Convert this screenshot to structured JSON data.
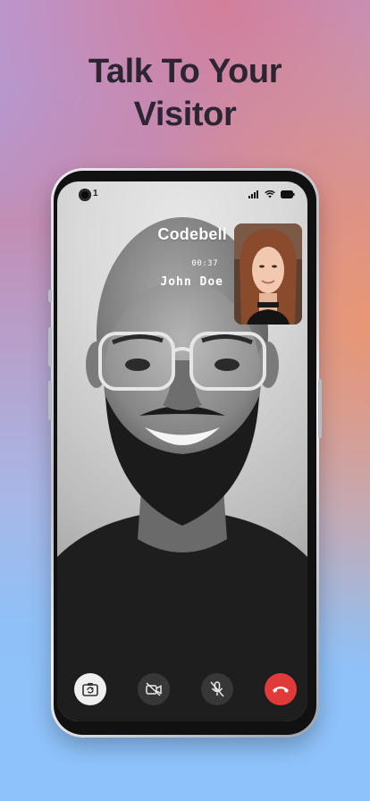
{
  "headline": {
    "line1": "Talk To Your",
    "line2": "Visitor"
  },
  "status_bar": {
    "indicator": "1",
    "icons": [
      "signal-icon",
      "wifi-icon",
      "battery-icon"
    ]
  },
  "call": {
    "brand": "Codebell",
    "timer": "00:37",
    "caller": "John Doe"
  },
  "controls": [
    {
      "name": "flip-camera-button",
      "icon": "camera-switch-icon"
    },
    {
      "name": "video-off-button",
      "icon": "video-off-icon"
    },
    {
      "name": "mute-button",
      "icon": "mic-off-icon"
    },
    {
      "name": "end-call-button",
      "icon": "phone-hangup-icon"
    }
  ],
  "colors": {
    "end_call": "#e03a3a",
    "headline": "#2c2532",
    "controls_dark": "#3c3c3c"
  }
}
